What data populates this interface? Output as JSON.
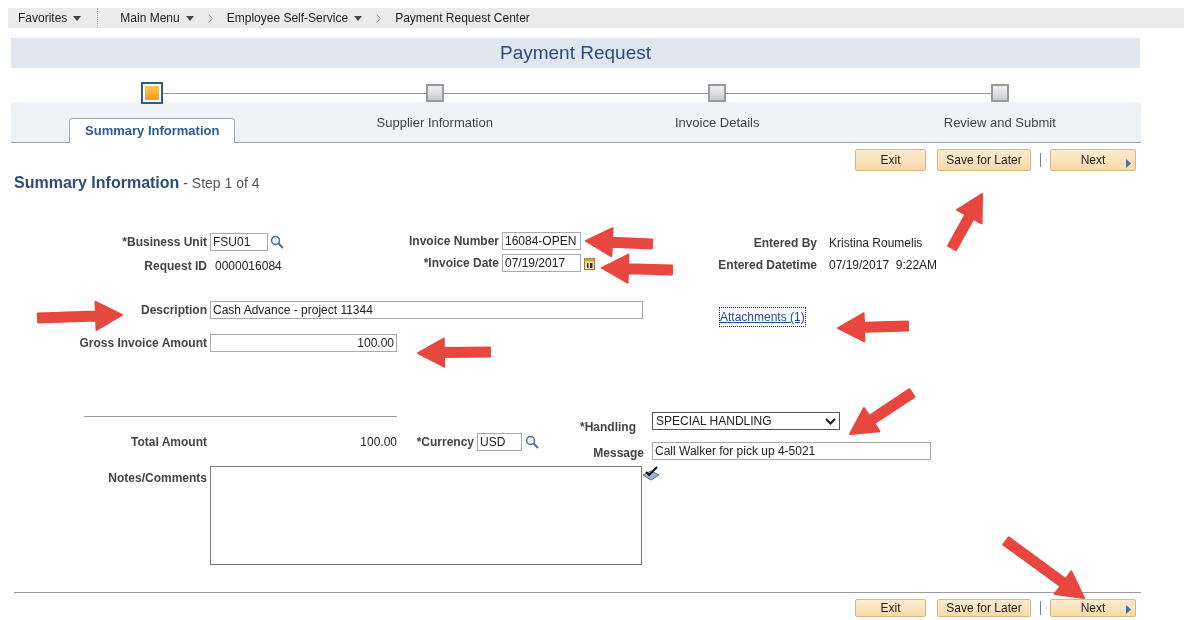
{
  "breadcrumb": [
    {
      "label": "Favorites",
      "dropdown": true
    },
    {
      "label": "Main Menu",
      "dropdown": true
    },
    {
      "label": "Employee Self-Service",
      "dropdown": true
    },
    {
      "label": "Payment Request Center",
      "dropdown": false
    }
  ],
  "page_title": "Payment Request",
  "steps": [
    {
      "label": "Summary Information",
      "selected": true
    },
    {
      "label": "Supplier Information",
      "selected": false
    },
    {
      "label": "Invoice Details",
      "selected": false
    },
    {
      "label": "Review and Submit",
      "selected": false
    }
  ],
  "top_buttons": [
    {
      "label": "Exit",
      "kind": "plain"
    },
    {
      "label": "Save for Later",
      "kind": "plain"
    },
    {
      "label": "Next",
      "kind": "next"
    }
  ],
  "heading": {
    "title": "Summary Information",
    "subtitle": "- Step 1 of 4"
  },
  "fields": {
    "business_unit": {
      "label": "*Business Unit",
      "value": "FSU01"
    },
    "request_id": {
      "label": "Request ID",
      "value": "0000016084"
    },
    "invoice_number": {
      "label": "Invoice Number",
      "value": "16084-OPEN"
    },
    "invoice_date": {
      "label": "*Invoice Date",
      "value": "07/19/2017"
    },
    "entered_by": {
      "label": "Entered By",
      "value": "Kristina Roumelis"
    },
    "entered_datetime": {
      "label": "Entered Datetime",
      "value": "07/19/2017  9:22AM"
    },
    "description": {
      "label": "Description",
      "value": "Cash Advance - project 11344"
    },
    "attachments": {
      "label": "Attachments (1)"
    },
    "gross_invoice_amount": {
      "label": "Gross Invoice Amount",
      "value": "100.00"
    },
    "handling": {
      "label": "*Handling",
      "value": "SPECIAL HANDLING"
    },
    "total_amount": {
      "label": "Total Amount",
      "value": "100.00"
    },
    "currency": {
      "label": "*Currency",
      "value": "USD"
    },
    "message": {
      "label": "Message",
      "value": "Call Walker for pick up 4-5021"
    },
    "notes_comments": {
      "label": "Notes/Comments"
    }
  },
  "bottom_buttons": [
    {
      "label": "Exit",
      "kind": "plain"
    },
    {
      "label": "Save for Later",
      "kind": "plain"
    },
    {
      "label": "Next",
      "kind": "next"
    }
  ]
}
